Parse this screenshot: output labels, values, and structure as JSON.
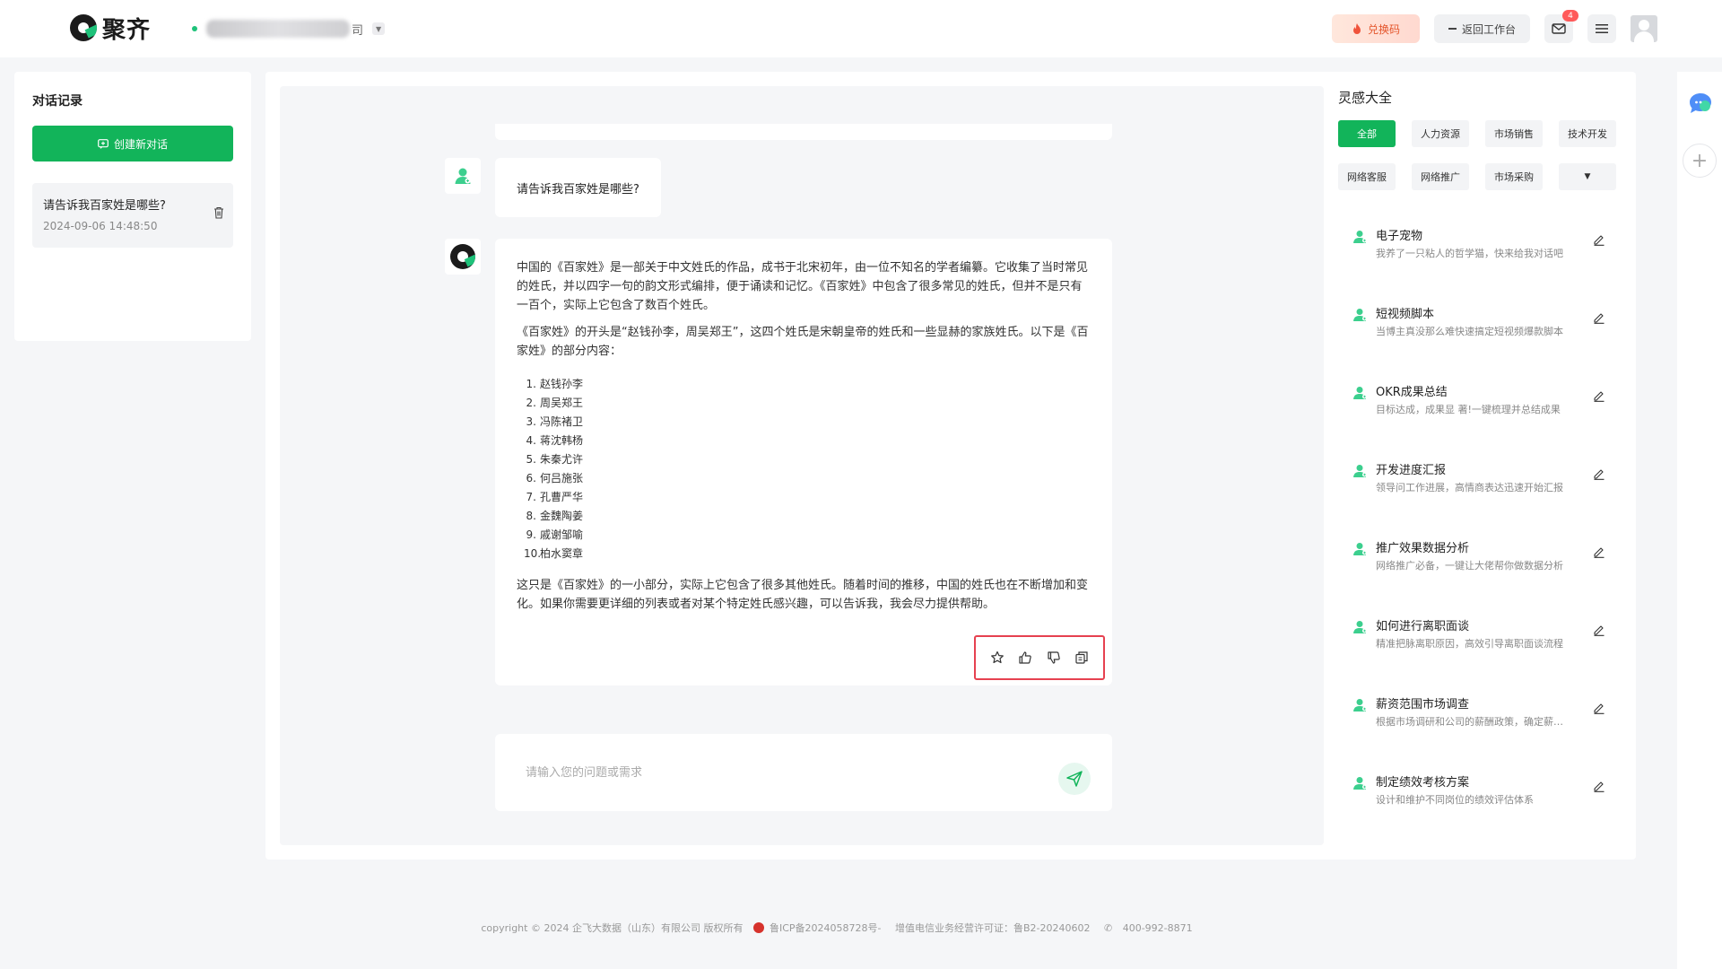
{
  "header": {
    "logo_text": "聚齐",
    "company_suffix": "司",
    "redeem_label": "兑换码",
    "back_label": "返回工作台",
    "mail_badge": "4"
  },
  "sidebar": {
    "title": "对话记录",
    "new_chat_label": "创建新对话",
    "history": [
      {
        "title": "请告诉我百家姓是哪些?",
        "time": "2024-09-06 14:48:50"
      }
    ]
  },
  "chat": {
    "user_message": "请告诉我百家姓是哪些?",
    "ai_paragraphs": [
      "中国的《百家姓》是一部关于中文姓氏的作品，成书于北宋初年，由一位不知名的学者编纂。它收集了当时常见的姓氏，并以四字一句的韵文形式编排，便于诵读和记忆。《百家姓》中包含了很多常见的姓氏，但并不是只有一百个，实际上它包含了数百个姓氏。",
      "《百家姓》的开头是“赵钱孙李，周吴郑王”，这四个姓氏是宋朝皇帝的姓氏和一些显赫的家族姓氏。以下是《百家姓》的部分内容："
    ],
    "ai_list": [
      "赵钱孙李",
      "周吴郑王",
      "冯陈褚卫",
      "蒋沈韩杨",
      "朱秦尤许",
      "何吕施张",
      "孔曹严华",
      "金魏陶姜",
      "戚谢邹喻",
      "柏水窦章"
    ],
    "ai_closing": "这只是《百家姓》的一小部分，实际上它包含了很多其他姓氏。随着时间的推移，中国的姓氏也在不断增加和变化。如果你需要更详细的列表或者对某个特定姓氏感兴趣，可以告诉我，我会尽力提供帮助。",
    "input_placeholder": "请输入您的问题或需求"
  },
  "inspiration": {
    "title": "灵感大全",
    "categories": [
      "全部",
      "人力资源",
      "市场销售",
      "技术开发",
      "网络客服",
      "网络推广",
      "市场采购"
    ],
    "items": [
      {
        "title": "电子宠物",
        "desc": "我养了一只粘人的哲学猫，快来给我对话吧"
      },
      {
        "title": "短视频脚本",
        "desc": "当博主真没那么难快速搞定短视频爆款脚本"
      },
      {
        "title": "OKR成果总结",
        "desc": "目标达成，成果显 著!一键梳理并总结成果"
      },
      {
        "title": "开发进度汇报",
        "desc": "领导问工作进展，高情商表达迅速开始汇报"
      },
      {
        "title": "推广效果数据分析",
        "desc": "网络推广必备，一键让大佬帮你做数据分析"
      },
      {
        "title": "如何进行离职面谈",
        "desc": "精准把脉离职原因，高效引导离职面谈流程"
      },
      {
        "title": "薪资范围市场调查",
        "desc": "根据市场调研和公司的薪酬政策，确定薪资范围"
      },
      {
        "title": "制定绩效考核方案",
        "desc": "设计和维护不同岗位的绩效评估体系"
      }
    ]
  },
  "footer": {
    "copyright": "copyright © 2024 企飞大数据（山东）有限公司 版权所有",
    "icp": "鲁ICP备2024058728号-",
    "license": "增值电信业务经营许可证：鲁B2-20240602",
    "phone": "400-992-8871"
  },
  "colors": {
    "accent": "#12b45a",
    "highlight_border": "#e64150",
    "redeem_text": "#e4552b"
  }
}
